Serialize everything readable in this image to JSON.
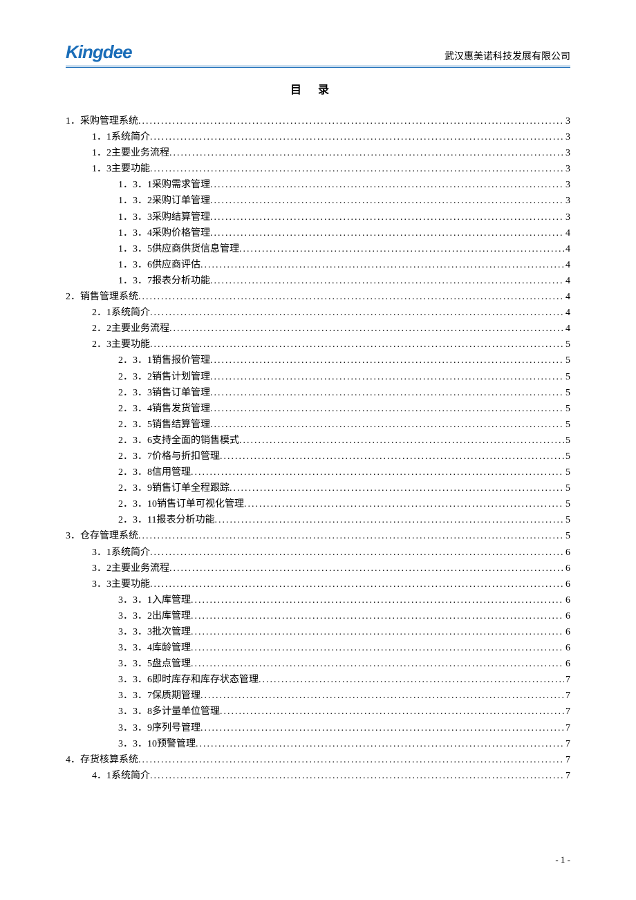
{
  "header": {
    "logo": "Kingdee",
    "company": "武汉惠美诺科技发展有限公司"
  },
  "title": "目录",
  "toc": [
    {
      "level": 1,
      "num": "1．",
      "label": "采购管理系统",
      "page": "3"
    },
    {
      "level": 2,
      "num": "1．1 ",
      "label": "系统简介",
      "page": "3"
    },
    {
      "level": 2,
      "num": "1．2 ",
      "label": "主要业务流程",
      "page": "3"
    },
    {
      "level": 2,
      "num": "1．3 ",
      "label": "主要功能",
      "page": "3"
    },
    {
      "level": 3,
      "num": "1．3．1 ",
      "label": "采购需求管理",
      "page": "3"
    },
    {
      "level": 3,
      "num": "1．3．2 ",
      "label": "采购订单管理",
      "page": "3"
    },
    {
      "level": 3,
      "num": "1．3．3 ",
      "label": "采购结算管理",
      "page": "3"
    },
    {
      "level": 3,
      "num": "1．3．4 ",
      "label": "采购价格管理",
      "page": "4"
    },
    {
      "level": 3,
      "num": "1．3．5 ",
      "label": "供应商供货信息管理",
      "page": "4"
    },
    {
      "level": 3,
      "num": "1．3．6 ",
      "label": "供应商评估",
      "page": "4"
    },
    {
      "level": 3,
      "num": "1．3．7 ",
      "label": "报表分析功能",
      "page": "4"
    },
    {
      "level": 1,
      "num": "2．",
      "label": "销售管理系统",
      "page": "4"
    },
    {
      "level": 2,
      "num": "2．1 ",
      "label": "系统简介",
      "page": "4"
    },
    {
      "level": 2,
      "num": "2．2 ",
      "label": "主要业务流程",
      "page": "4"
    },
    {
      "level": 2,
      "num": "2．3 ",
      "label": "主要功能",
      "page": "5"
    },
    {
      "level": 3,
      "num": "2．3．1 ",
      "label": "销售报价管理",
      "page": "5"
    },
    {
      "level": 3,
      "num": "2．3．2 ",
      "label": "销售计划管理",
      "page": "5"
    },
    {
      "level": 3,
      "num": "2．3．3 ",
      "label": "销售订单管理",
      "page": "5"
    },
    {
      "level": 3,
      "num": "2．3．4 ",
      "label": "销售发货管理",
      "page": "5"
    },
    {
      "level": 3,
      "num": "2．3．5 ",
      "label": "销售结算管理",
      "page": "5"
    },
    {
      "level": 3,
      "num": "2．3．6 ",
      "label": "支持全面的销售模式",
      "page": "5"
    },
    {
      "level": 3,
      "num": "2．3．7 ",
      "label": "价格与折扣管理",
      "page": "5"
    },
    {
      "level": 3,
      "num": "2．3．8 ",
      "label": "信用管理",
      "page": "5"
    },
    {
      "level": 3,
      "num": "2．3．9 ",
      "label": "销售订单全程跟踪",
      "page": "5"
    },
    {
      "level": 3,
      "num": "2．3．10 ",
      "label": "销售订单可视化管理",
      "page": "5"
    },
    {
      "level": 3,
      "num": "2．3．11 ",
      "label": "报表分析功能",
      "page": "5"
    },
    {
      "level": 1,
      "num": "3．",
      "label": "仓存管理系统",
      "page": "5"
    },
    {
      "level": 2,
      "num": "3．1 ",
      "label": "系统简介",
      "page": "6"
    },
    {
      "level": 2,
      "num": "3．2 ",
      "label": "主要业务流程",
      "page": "6"
    },
    {
      "level": 2,
      "num": "3．3 ",
      "label": "主要功能",
      "page": "6"
    },
    {
      "level": 3,
      "num": "3．3．1 ",
      "label": "入库管理",
      "page": "6"
    },
    {
      "level": 3,
      "num": "3．3．2 ",
      "label": "出库管理",
      "page": "6"
    },
    {
      "level": 3,
      "num": "3．3．3 ",
      "label": "批次管理",
      "page": "6"
    },
    {
      "level": 3,
      "num": "3．3．4 ",
      "label": "库龄管理",
      "page": "6"
    },
    {
      "level": 3,
      "num": "3．3．5 ",
      "label": "盘点管理",
      "page": "6"
    },
    {
      "level": 3,
      "num": "3．3．6 ",
      "label": "即时库存和库存状态管理",
      "page": "7"
    },
    {
      "level": 3,
      "num": "3．3．7 ",
      "label": "保质期管理",
      "page": "7"
    },
    {
      "level": 3,
      "num": "3．3．8 ",
      "label": "多计量单位管理",
      "page": "7"
    },
    {
      "level": 3,
      "num": "3．3．9 ",
      "label": "序列号管理",
      "page": "7"
    },
    {
      "level": 3,
      "num": "3．3．10 ",
      "label": "预警管理",
      "page": "7"
    },
    {
      "level": 1,
      "num": "4．",
      "label": "存货核算系统",
      "page": "7"
    },
    {
      "level": 2,
      "num": "4．1 ",
      "label": "系统简介",
      "page": "7"
    }
  ],
  "footer": {
    "page_number": "- 1 -"
  }
}
